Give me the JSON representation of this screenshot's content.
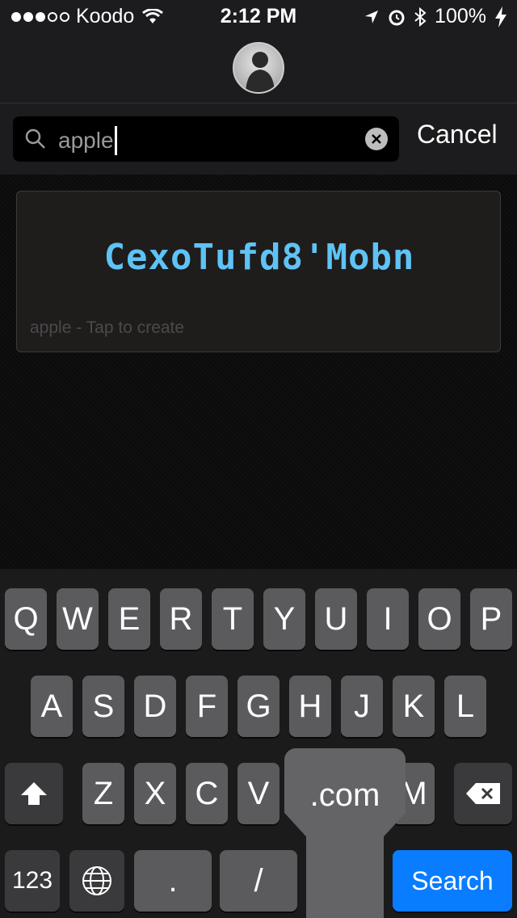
{
  "status_bar": {
    "carrier": "Koodo",
    "time": "2:12 PM",
    "battery": "100%"
  },
  "search": {
    "query": "apple",
    "cancel_label": "Cancel"
  },
  "result": {
    "password": "CexoTufd8'Mobn",
    "hint": "apple - Tap to create"
  },
  "keyboard": {
    "row1": [
      "Q",
      "W",
      "E",
      "R",
      "T",
      "Y",
      "U",
      "I",
      "O",
      "P"
    ],
    "row2": [
      "A",
      "S",
      "D",
      "F",
      "G",
      "H",
      "J",
      "K",
      "L"
    ],
    "row3": [
      "Z",
      "X",
      "C",
      "V",
      "M"
    ],
    "numbers_label": "123",
    "dot_label": ".",
    "slash_label": "/",
    "search_label": "Search",
    "popup_label": ".com"
  },
  "colors": {
    "accent": "#0a7cff",
    "password": "#5ec3f5"
  }
}
